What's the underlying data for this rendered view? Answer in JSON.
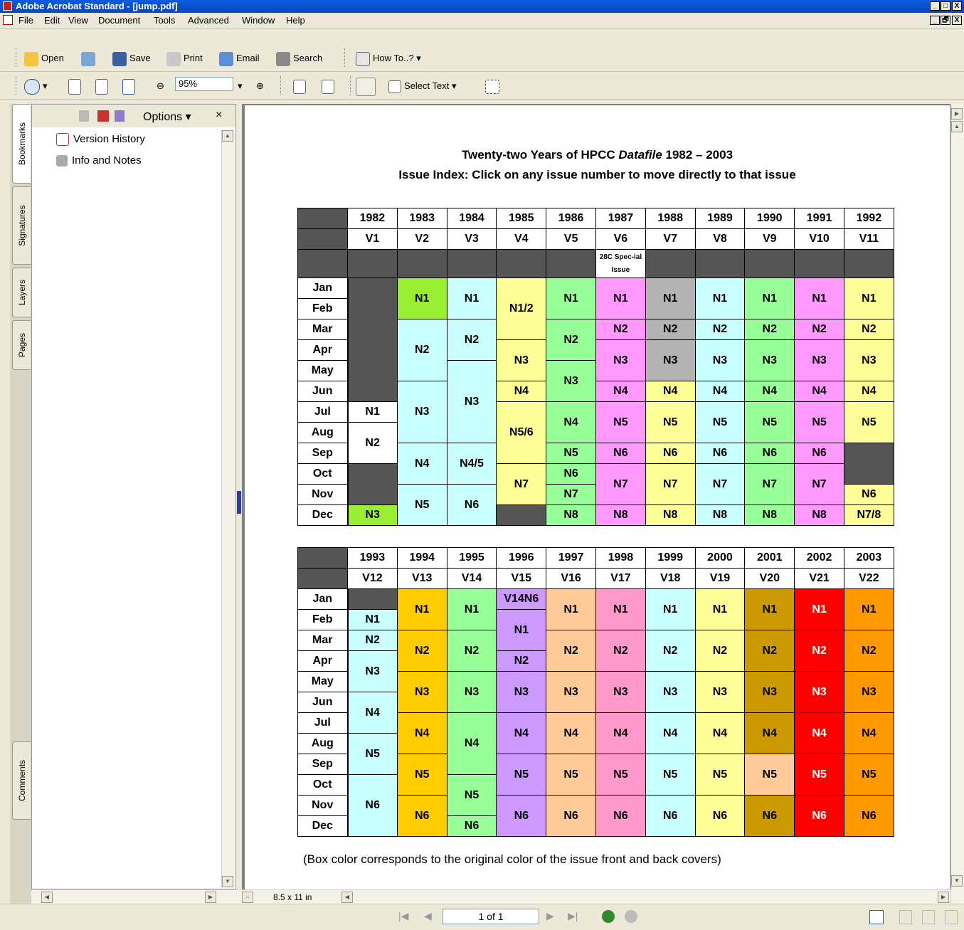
{
  "window": {
    "title": "Adobe Acrobat Standard - [jump.pdf]",
    "controls": [
      "_",
      "□",
      "X"
    ],
    "doc_controls": [
      "_",
      "🗗",
      "X"
    ]
  },
  "menu": [
    "File",
    "Edit",
    "View",
    "Document",
    "Tools",
    "Advanced",
    "Window",
    "Help"
  ],
  "toolbar1": {
    "open": "Open",
    "save": "Save",
    "print": "Print",
    "email": "Email",
    "search": "Search",
    "howto": "How To..?"
  },
  "toolbar2": {
    "zoom": "95%",
    "select_text": "Select Text"
  },
  "side_tabs": [
    "Bookmarks",
    "Signatures",
    "Layers",
    "Pages",
    "Comments"
  ],
  "bookmarks": {
    "options": "Options",
    "items": [
      "Version History",
      "Info and Notes"
    ]
  },
  "page_size": "8.5 x 11 in",
  "page_indicator": "1 of 1",
  "document": {
    "title_line1_a": "Twenty-two Years of HPCC ",
    "title_line1_b": "Datafile",
    "title_line1_c": " 1982 – 2003",
    "title_line2": "Issue Index: Click on any issue number to move directly to that issue",
    "note": "(Box color corresponds to the original color of the issue front and back covers)"
  },
  "months": [
    "Jan",
    "Feb",
    "Mar",
    "Apr",
    "May",
    "Jun",
    "Jul",
    "Aug",
    "Sep",
    "Oct",
    "Nov",
    "Dec"
  ],
  "table1": {
    "years": [
      "1982",
      "1983",
      "1984",
      "1985",
      "1986",
      "1987",
      "1988",
      "1989",
      "1990",
      "1991",
      "1992"
    ],
    "volumes": [
      "V1",
      "V2",
      "V3",
      "V4",
      "V5",
      "V6",
      "V7",
      "V8",
      "V9",
      "V10",
      "V11"
    ],
    "special": [
      null,
      null,
      null,
      null,
      null,
      "28C Spec-ial Issue",
      null,
      null,
      null,
      null,
      null
    ],
    "columns": [
      [
        [
          "",
          6,
          "#555555"
        ],
        [
          "N1",
          1,
          "#ffffff"
        ],
        [
          "N2",
          2,
          "#ffffff"
        ],
        [
          "",
          2,
          "#555555"
        ],
        [
          "N3",
          1,
          "#99ee33"
        ]
      ],
      [
        [
          "N1",
          2,
          "#99ee33"
        ],
        [
          "N2",
          3,
          "#c9ffff"
        ],
        [
          "N3",
          3,
          "#c9ffff"
        ],
        [
          "N4",
          2,
          "#c9ffff"
        ],
        [
          "N5",
          2,
          "#c9ffff"
        ]
      ],
      [
        [
          "N1",
          2,
          "#c9ffff"
        ],
        [
          "N2",
          2,
          "#c9ffff"
        ],
        [
          "N3",
          4,
          "#c9ffff"
        ],
        [
          "N4/5",
          2,
          "#c9ffff"
        ],
        [
          "N6",
          2,
          "#c9ffff"
        ]
      ],
      [
        [
          "N1/2",
          3,
          "#ffff99"
        ],
        [
          "N3",
          2,
          "#ffff99"
        ],
        [
          "N4",
          1,
          "#ffff99"
        ],
        [
          "N5/6",
          3,
          "#ffff99"
        ],
        [
          "N7",
          2,
          "#ffff99"
        ],
        [
          "",
          1,
          "#555555"
        ]
      ],
      [
        [
          "N1",
          2,
          "#99ff99"
        ],
        [
          "N2",
          2,
          "#99ff99"
        ],
        [
          "N3",
          2,
          "#99ff99"
        ],
        [
          "N4",
          2,
          "#99ff99"
        ],
        [
          "N5",
          1,
          "#99ff99"
        ],
        [
          "N6",
          1,
          "#99ff99"
        ],
        [
          "N7",
          1,
          "#99ff99"
        ],
        [
          "N8",
          1,
          "#99ff99"
        ]
      ],
      [
        [
          "N1",
          2,
          "#ff99ff"
        ],
        [
          "N2",
          1,
          "#ff99ff"
        ],
        [
          "N3",
          2,
          "#ff99ff"
        ],
        [
          "N4",
          1,
          "#ff99ff"
        ],
        [
          "N5",
          2,
          "#ff99ff"
        ],
        [
          "N6",
          1,
          "#ff99ff"
        ],
        [
          "N7",
          2,
          "#ff99ff"
        ],
        [
          "N8",
          1,
          "#ff99ff"
        ]
      ],
      [
        [
          "N1",
          2,
          "#b3b3b3"
        ],
        [
          "N2",
          1,
          "#b3b3b3"
        ],
        [
          "N3",
          2,
          "#b3b3b3"
        ],
        [
          "N4",
          1,
          "#ffff99"
        ],
        [
          "N5",
          2,
          "#ffff99"
        ],
        [
          "N6",
          1,
          "#ffff99"
        ],
        [
          "N7",
          2,
          "#ffff99"
        ],
        [
          "N8",
          1,
          "#ffff99"
        ]
      ],
      [
        [
          "N1",
          2,
          "#c9ffff"
        ],
        [
          "N2",
          1,
          "#c9ffff"
        ],
        [
          "N3",
          2,
          "#c9ffff"
        ],
        [
          "N4",
          1,
          "#c9ffff"
        ],
        [
          "N5",
          2,
          "#c9ffff"
        ],
        [
          "N6",
          1,
          "#c9ffff"
        ],
        [
          "N7",
          2,
          "#c9ffff"
        ],
        [
          "N8",
          1,
          "#c9ffff"
        ]
      ],
      [
        [
          "N1",
          2,
          "#99ff99"
        ],
        [
          "N2",
          1,
          "#99ff99"
        ],
        [
          "N3",
          2,
          "#99ff99"
        ],
        [
          "N4",
          1,
          "#99ff99"
        ],
        [
          "N5",
          2,
          "#99ff99"
        ],
        [
          "N6",
          1,
          "#99ff99"
        ],
        [
          "N7",
          2,
          "#99ff99"
        ],
        [
          "N8",
          1,
          "#99ff99"
        ]
      ],
      [
        [
          "N1",
          2,
          "#ff99ff"
        ],
        [
          "N2",
          1,
          "#ff99ff"
        ],
        [
          "N3",
          2,
          "#ff99ff"
        ],
        [
          "N4",
          1,
          "#ff99ff"
        ],
        [
          "N5",
          2,
          "#ff99ff"
        ],
        [
          "N6",
          1,
          "#ff99ff"
        ],
        [
          "N7",
          2,
          "#ff99ff"
        ],
        [
          "N8",
          1,
          "#ff99ff"
        ]
      ],
      [
        [
          "N1",
          2,
          "#ffff99"
        ],
        [
          "N2",
          1,
          "#ffff99"
        ],
        [
          "N3",
          2,
          "#ffff99"
        ],
        [
          "N4",
          1,
          "#ffff99"
        ],
        [
          "N5",
          2,
          "#ffff99"
        ],
        [
          "",
          2,
          "#555555"
        ],
        [
          "N6",
          1,
          "#ffff99"
        ],
        [
          "N7/8",
          1,
          "#ffff99"
        ]
      ]
    ]
  },
  "table2": {
    "years": [
      "1993",
      "1994",
      "1995",
      "1996",
      "1997",
      "1998",
      "1999",
      "2000",
      "2001",
      "2002",
      "2003"
    ],
    "volumes": [
      "V12",
      "V13",
      "V14",
      "V15",
      "V16",
      "V17",
      "V18",
      "V19",
      "V20",
      "V21",
      "V22"
    ],
    "columns": [
      [
        [
          "",
          1,
          "#555555"
        ],
        [
          "N1",
          1,
          "#c9ffff"
        ],
        [
          "N2",
          1,
          "#c9ffff"
        ],
        [
          "N3",
          2,
          "#c9ffff"
        ],
        [
          "N4",
          2,
          "#c9ffff"
        ],
        [
          "N5",
          2,
          "#c9ffff"
        ],
        [
          "N6",
          3,
          "#c9ffff"
        ]
      ],
      [
        [
          "N1",
          2,
          "#ffcc00"
        ],
        [
          "N2",
          2,
          "#ffcc00"
        ],
        [
          "N3",
          2,
          "#ffcc00"
        ],
        [
          "N4",
          2,
          "#ffcc00"
        ],
        [
          "N5",
          2,
          "#ffcc00"
        ],
        [
          "N6",
          2,
          "#ffcc00"
        ]
      ],
      [
        [
          "N1",
          2,
          "#99ff99"
        ],
        [
          "N2",
          2,
          "#99ff99"
        ],
        [
          "N3",
          2,
          "#99ff99"
        ],
        [
          "N4",
          3,
          "#99ff99"
        ],
        [
          "N5",
          2,
          "#99ff99"
        ],
        [
          "N6",
          1,
          "#99ff99"
        ]
      ],
      [
        [
          "V14N6",
          1,
          "#cc99ff"
        ],
        [
          "N1",
          2,
          "#cc99ff"
        ],
        [
          "N2",
          1,
          "#cc99ff"
        ],
        [
          "N3",
          2,
          "#cc99ff"
        ],
        [
          "N4",
          2,
          "#cc99ff"
        ],
        [
          "N5",
          2,
          "#cc99ff"
        ],
        [
          "N6",
          2,
          "#cc99ff"
        ]
      ],
      [
        [
          "N1",
          2,
          "#ffcc99"
        ],
        [
          "N2",
          2,
          "#ffcc99"
        ],
        [
          "N3",
          2,
          "#ffcc99"
        ],
        [
          "N4",
          2,
          "#ffcc99"
        ],
        [
          "N5",
          2,
          "#ffcc99"
        ],
        [
          "N6",
          2,
          "#ffcc99"
        ]
      ],
      [
        [
          "N1",
          2,
          "#ff99cc"
        ],
        [
          "N2",
          2,
          "#ff99cc"
        ],
        [
          "N3",
          2,
          "#ff99cc"
        ],
        [
          "N4",
          2,
          "#ff99cc"
        ],
        [
          "N5",
          2,
          "#ff99cc"
        ],
        [
          "N6",
          2,
          "#ff99cc"
        ]
      ],
      [
        [
          "N1",
          2,
          "#c9ffff"
        ],
        [
          "N2",
          2,
          "#c9ffff"
        ],
        [
          "N3",
          2,
          "#c9ffff"
        ],
        [
          "N4",
          2,
          "#c9ffff"
        ],
        [
          "N5",
          2,
          "#c9ffff"
        ],
        [
          "N6",
          2,
          "#c9ffff"
        ]
      ],
      [
        [
          "N1",
          2,
          "#ffff99"
        ],
        [
          "N2",
          2,
          "#ffff99"
        ],
        [
          "N3",
          2,
          "#ffff99"
        ],
        [
          "N4",
          2,
          "#ffff99"
        ],
        [
          "N5",
          2,
          "#ffff99"
        ],
        [
          "N6",
          2,
          "#ffff99"
        ]
      ],
      [
        [
          "N1",
          2,
          "#cc9900"
        ],
        [
          "N2",
          2,
          "#cc9900"
        ],
        [
          "N3",
          2,
          "#cc9900"
        ],
        [
          "N4",
          2,
          "#cc9900"
        ],
        [
          "N5",
          2,
          "#ffcc99"
        ],
        [
          "N6",
          2,
          "#cc9900"
        ]
      ],
      [
        [
          "N1",
          2,
          "#ff0000"
        ],
        [
          "N2",
          2,
          "#ff0000"
        ],
        [
          "N3",
          2,
          "#ff0000"
        ],
        [
          "N4",
          2,
          "#ff0000"
        ],
        [
          "N5",
          2,
          "#ff0000"
        ],
        [
          "N6",
          2,
          "#ff0000"
        ]
      ],
      [
        [
          "N1",
          2,
          "#ff9900"
        ],
        [
          "N2",
          2,
          "#ff9900"
        ],
        [
          "N3",
          2,
          "#ff9900"
        ],
        [
          "N4",
          2,
          "#ff9900"
        ],
        [
          "N5",
          2,
          "#ff9900"
        ],
        [
          "N6",
          2,
          "#ff9900"
        ]
      ]
    ]
  }
}
